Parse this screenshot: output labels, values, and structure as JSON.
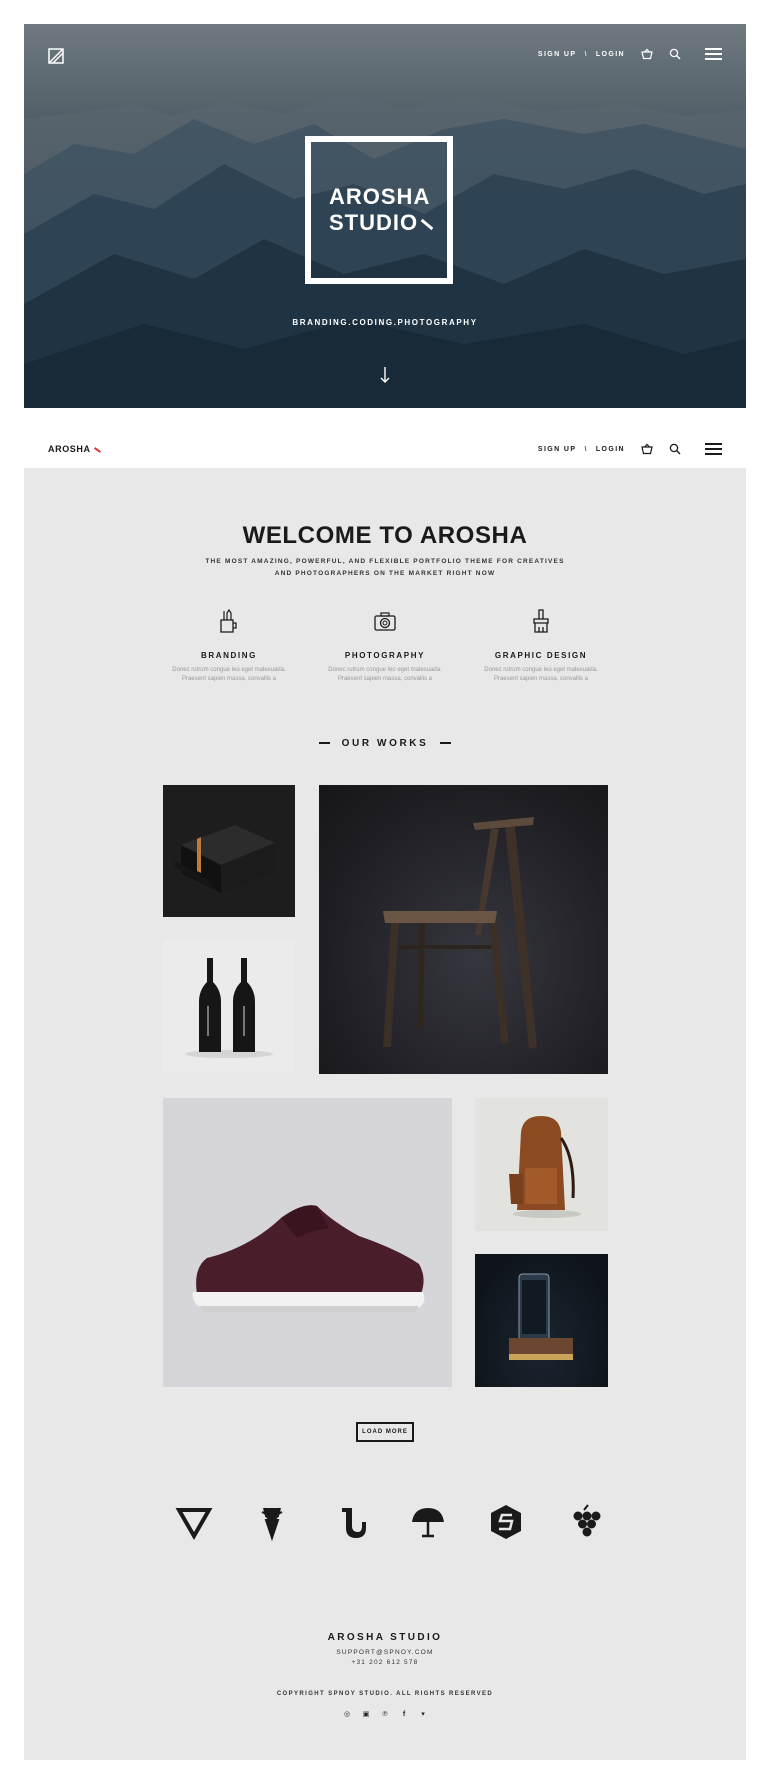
{
  "hero": {
    "title_line1": "AROSHA",
    "title_line2": "STUDIO",
    "tagline": "BRANDING.CODING.PHOTOGRAPHY"
  },
  "nav": {
    "brand": "AROSHA",
    "signup": "SIGN UP",
    "separator": "\\",
    "login": "LOGIN",
    "icons": [
      "basket-icon",
      "search-icon",
      "menu-icon"
    ]
  },
  "welcome": {
    "title": "WELCOME TO AROSHA",
    "subtitle": "THE MOST AMAZING, POWERFUL, AND FLEXIBLE PORTFOLIO THEME FOR CREATIVES AND PHOTOGRAPHERS ON THE MARKET RIGHT NOW"
  },
  "services": [
    {
      "icon": "pencil-cup-icon",
      "title": "BRANDING",
      "text_line1": "Donec rutrum congue leo eget malesuada.",
      "text_line2": "Praesent sapien massa, convallis a"
    },
    {
      "icon": "camera-icon",
      "title": "PHOTOGRAPHY",
      "text_line1": "Donec rutrum congue leo eget malesuada.",
      "text_line2": "Praesent sapien massa, convallis a"
    },
    {
      "icon": "paintbrush-icon",
      "title": "GRAPHIC DESIGN",
      "text_line1": "Donec rutrum congue leo eget malesuada.",
      "text_line2": "Praesent sapien massa, convallis a"
    }
  ],
  "works": {
    "title": "OUR WORKS",
    "items": [
      "black-box-packaging",
      "wine-bottles",
      "wooden-chair",
      "burgundy-sneaker",
      "leather-backpack",
      "phone-dock"
    ],
    "load_more": "LOAD MORE"
  },
  "clients": [
    "triangle-logo-icon",
    "deer-logo-icon",
    "saxophone-logo-icon",
    "umbrella-logo-icon",
    "s-hexagon-logo-icon",
    "grapes-logo-icon"
  ],
  "footer": {
    "brand": "AROSHA STUDIO",
    "email": "SUPPORT@SPNOY.COM",
    "phone": "+31 202 612 578",
    "copyright": "COPYRIGHT SPNOY STUDIO. ALL RIGHTS RESERVED",
    "social": [
      "dribbble-icon",
      "instagram-icon",
      "pinterest-icon",
      "facebook-icon",
      "twitter-icon"
    ]
  },
  "colors": {
    "accent": "#e0352b",
    "page_bg": "#e8e8e8",
    "text": "#1a1a1a"
  }
}
